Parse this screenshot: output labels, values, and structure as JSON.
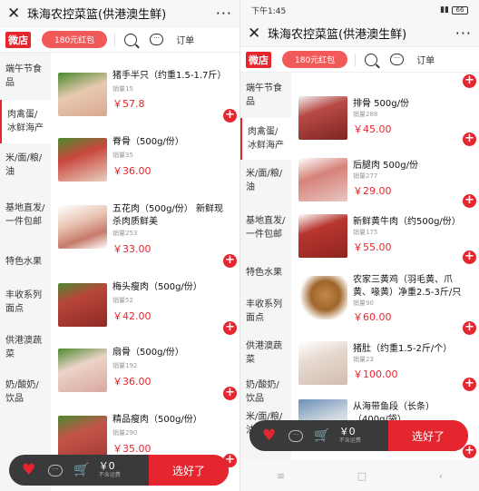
{
  "left": {
    "title": "珠海农控菜篮(供港澳生鲜)",
    "shop_logo": "微店",
    "redpack": "180元红包",
    "order": "订单",
    "categories": [
      "端午节食品",
      "肉禽蛋/冰鲜海产",
      "米/面/粮/油",
      "基地直发/一件包邮",
      "特色水果",
      "丰收系列面点",
      "供港澳蔬菜",
      "奶/酸奶/饮品"
    ],
    "items": [
      {
        "name": "猪手半只（约重1.5-1.7斤）",
        "sold": "销量15",
        "price": "￥57.8"
      },
      {
        "name": "脊骨（500g/份）",
        "sold": "销量35",
        "price": "￥36.00"
      },
      {
        "name": "五花肉（500g/份） 新鲜现杀肉质鲜美",
        "sold": "销量253",
        "price": "￥33.00"
      },
      {
        "name": "梅头瘦肉（500g/份）",
        "sold": "销量52",
        "price": "￥42.00"
      },
      {
        "name": "扇骨（500g/份）",
        "sold": "销量192",
        "price": "￥36.00"
      },
      {
        "name": "精品瘦肉（500g/份）",
        "sold": "销量290",
        "price": "￥35.00"
      }
    ],
    "cart": {
      "amount": "￥0",
      "note": "不含运费",
      "checkout": "选好了"
    }
  },
  "right": {
    "status_time": "下午1:45",
    "status_battery": "66",
    "title": "珠海农控菜篮(供港澳生鲜)",
    "shop_logo": "微店",
    "redpack": "180元红包",
    "order": "订单",
    "categories": [
      "端午节食品",
      "肉禽蛋/冰鲜海产",
      "米/面/粮/油",
      "基地直发/一件包邮",
      "特色水果",
      "丰收系列面点",
      "供港澳蔬菜",
      "奶/酸奶/饮品",
      "米/面/粮/油"
    ],
    "items": [
      {
        "name": "排骨 500g/份",
        "sold": "销量288",
        "price": "￥45.00"
      },
      {
        "name": "后腿肉 500g/份",
        "sold": "销量277",
        "price": "￥29.00"
      },
      {
        "name": "新鲜黄牛肉（约500g/份）",
        "sold": "销量175",
        "price": "￥55.00"
      },
      {
        "name": "农家三黄鸡（羽毛黄、爪黄、喙黄）净重2.5-3斤/只",
        "sold": "销量90",
        "price": "￥60.00"
      },
      {
        "name": "猪肚（约重1.5-2斤/个）",
        "sold": "销量23",
        "price": "￥100.00"
      },
      {
        "name": "从海带鱼段（长条）（400g/袋）",
        "sold": "",
        "price": ""
      }
    ],
    "cart": {
      "amount": "￥0",
      "note": "不含运费",
      "checkout": "选好了"
    }
  },
  "icons": {
    "close": "close-icon",
    "more": "more-icon",
    "search": "search-icon",
    "message": "message-icon",
    "heart": "heart-icon",
    "cart": "cart-icon",
    "add": "add-icon"
  },
  "colors": {
    "accent": "#e6262e",
    "redpack": "#f25a5a",
    "cartbar": "#3a3a3a"
  }
}
